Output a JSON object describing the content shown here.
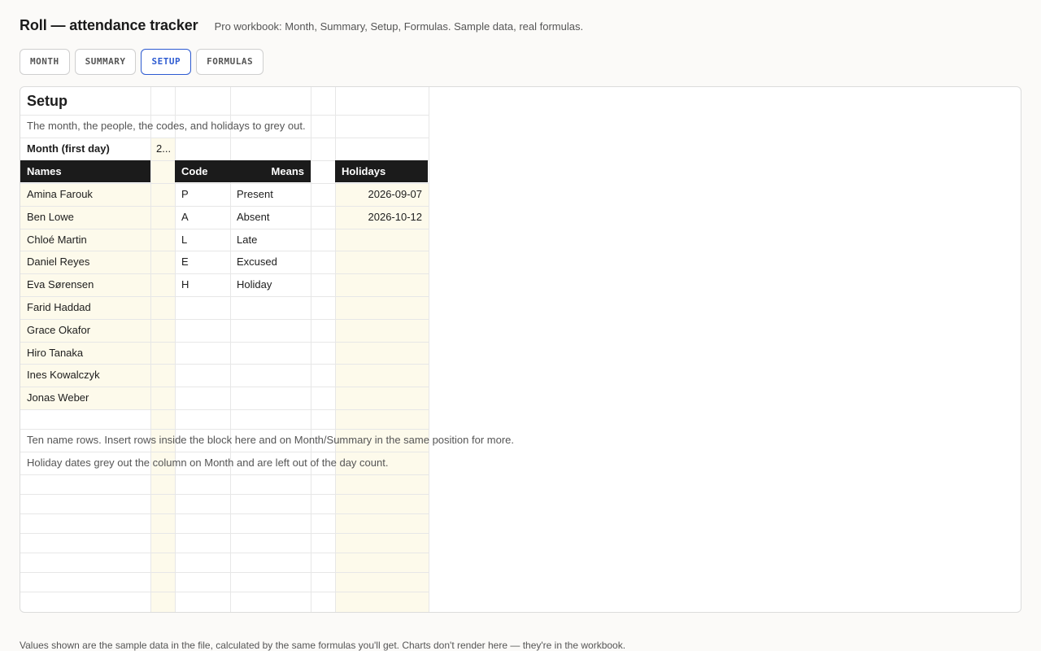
{
  "app": {
    "title": "Roll — attendance tracker",
    "subtitle": "Pro workbook: Month, Summary, Setup, Formulas. Sample data, real formulas."
  },
  "tabs": [
    {
      "label": "MONTH",
      "active": false
    },
    {
      "label": "SUMMARY",
      "active": false
    },
    {
      "label": "SETUP",
      "active": true
    },
    {
      "label": "FORMULAS",
      "active": false
    }
  ],
  "setup": {
    "title": "Setup",
    "description": "The month, the people, the codes, and holidays to grey out.",
    "month_label": "Month (first day)",
    "month_value": "2...",
    "headers": {
      "names": "Names",
      "code": "Code",
      "means": "Means",
      "holidays": "Holidays"
    },
    "names": [
      "Amina Farouk",
      "Ben Lowe",
      "Chloé Martin",
      "Daniel Reyes",
      "Eva Sørensen",
      "Farid Haddad",
      "Grace Okafor",
      "Hiro Tanaka",
      "Ines Kowalczyk",
      "Jonas Weber"
    ],
    "codes": [
      {
        "code": "P",
        "means": "Present"
      },
      {
        "code": "A",
        "means": "Absent"
      },
      {
        "code": "L",
        "means": "Late"
      },
      {
        "code": "E",
        "means": "Excused"
      },
      {
        "code": "H",
        "means": "Holiday"
      }
    ],
    "holidays": [
      "2026-09-07",
      "2026-10-12"
    ],
    "notes": [
      "Ten name rows. Insert rows inside the block here and on Month/Summary in the same position for more.",
      "Holiday dates grey out the column on Month and are left out of the day count."
    ]
  },
  "footer": "Values shown are the sample data in the file, calculated by the same formulas you'll get. Charts don't render here — they're in the workbook."
}
